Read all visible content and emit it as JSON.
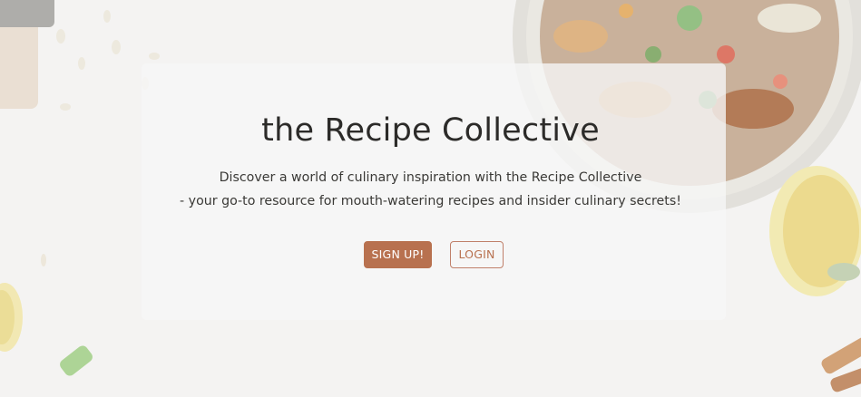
{
  "hero": {
    "title": "the Recipe Collective",
    "description_line1": "Discover a world of culinary inspiration with the Recipe Collective",
    "description_line2": "- your go-to resource for mouth-watering recipes and insider culinary secrets!"
  },
  "actions": {
    "signup_label": "SIGN UP!",
    "login_label": "LOGIN"
  },
  "colors": {
    "accent": "#b8714f",
    "title_text": "#2c2b29",
    "card_background": "#f6f6f6",
    "page_background": "#f3f2f1"
  },
  "icons": {
    "background": "food-photo-background"
  }
}
